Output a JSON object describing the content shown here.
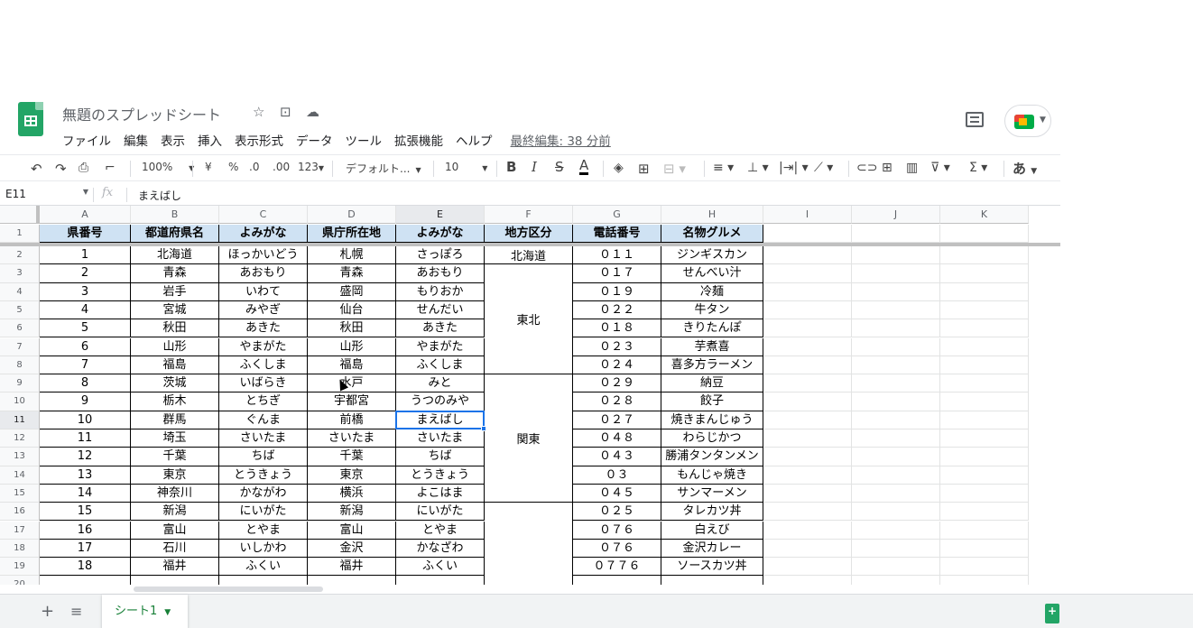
{
  "header": {
    "title": "無題のスプレッドシート",
    "menus": [
      "ファイル",
      "編集",
      "表示",
      "挿入",
      "表示形式",
      "データ",
      "ツール",
      "拡張機能",
      "ヘルプ"
    ],
    "last_edit": "最終編集: 38 分前"
  },
  "toolbar": {
    "zoom": "100%",
    "currency": "¥",
    "percent": "%",
    "dec_decrease": ".0",
    "dec_increase": ".00",
    "more_formats": "123",
    "font": "デフォルト...",
    "font_size": "10",
    "bold": "B",
    "italic": "I",
    "strike": "S",
    "text_color": "A",
    "sum": "Σ",
    "input_mode": "あ"
  },
  "formula_bar": {
    "cell_ref": "E11",
    "fx": "fx",
    "value": "まえばし"
  },
  "columns": [
    "A",
    "B",
    "C",
    "D",
    "E",
    "F",
    "G",
    "H",
    "I",
    "J",
    "K"
  ],
  "rows": [
    "1",
    "2",
    "3",
    "4",
    "5",
    "6",
    "7",
    "8",
    "9",
    "10",
    "11",
    "12",
    "13",
    "14",
    "15",
    "16",
    "17",
    "18",
    "19",
    "20"
  ],
  "table": {
    "headers": [
      "県番号",
      "都道府県名",
      "よみがな",
      "県庁所在地",
      "よみがな",
      "地方区分",
      "電話番号",
      "名物グルメ"
    ],
    "data": [
      [
        "1",
        "北海道",
        "ほっかいどう",
        "札幌",
        "さっぽろ",
        "０１１",
        "ジンギスカン"
      ],
      [
        "2",
        "青森",
        "あおもり",
        "青森",
        "あおもり",
        "０１７",
        "せんべい汁"
      ],
      [
        "3",
        "岩手",
        "いわて",
        "盛岡",
        "もりおか",
        "０１９",
        "冷麺"
      ],
      [
        "4",
        "宮城",
        "みやぎ",
        "仙台",
        "せんだい",
        "０２２",
        "牛タン"
      ],
      [
        "5",
        "秋田",
        "あきた",
        "秋田",
        "あきた",
        "０１８",
        "きりたんぽ"
      ],
      [
        "6",
        "山形",
        "やまがた",
        "山形",
        "やまがた",
        "０２３",
        "芋煮喜"
      ],
      [
        "7",
        "福島",
        "ふくしま",
        "福島",
        "ふくしま",
        "０２４",
        "喜多方ラーメン"
      ],
      [
        "8",
        "茨城",
        "いばらき",
        "水戸",
        "みと",
        "０２９",
        "納豆"
      ],
      [
        "9",
        "栃木",
        "とちぎ",
        "宇都宮",
        "うつのみや",
        "０２８",
        "餃子"
      ],
      [
        "10",
        "群馬",
        "ぐんま",
        "前橋",
        "まえばし",
        "０２７",
        "焼きまんじゅう"
      ],
      [
        "11",
        "埼玉",
        "さいたま",
        "さいたま",
        "さいたま",
        "０４８",
        "わらじかつ"
      ],
      [
        "12",
        "千葉",
        "ちば",
        "千葉",
        "ちば",
        "０４３",
        "勝浦タンタンメン"
      ],
      [
        "13",
        "東京",
        "とうきょう",
        "東京",
        "とうきょう",
        "０３",
        "もんじゃ焼き"
      ],
      [
        "14",
        "神奈川",
        "かながわ",
        "横浜",
        "よこはま",
        "０４５",
        "サンマーメン"
      ],
      [
        "15",
        "新潟",
        "にいがた",
        "新潟",
        "にいがた",
        "０２５",
        "タレカツ丼"
      ],
      [
        "16",
        "富山",
        "とやま",
        "富山",
        "とやま",
        "０７６",
        "白えび"
      ],
      [
        "17",
        "石川",
        "いしかわ",
        "金沢",
        "かなざわ",
        "０７６",
        "金沢カレー"
      ],
      [
        "18",
        "福井",
        "ふくい",
        "福井",
        "ふくい",
        "０７７６",
        "ソースカツ丼"
      ]
    ],
    "regions": [
      "北海道",
      "東北",
      "関東"
    ]
  },
  "sheets": {
    "active": "シート1"
  }
}
